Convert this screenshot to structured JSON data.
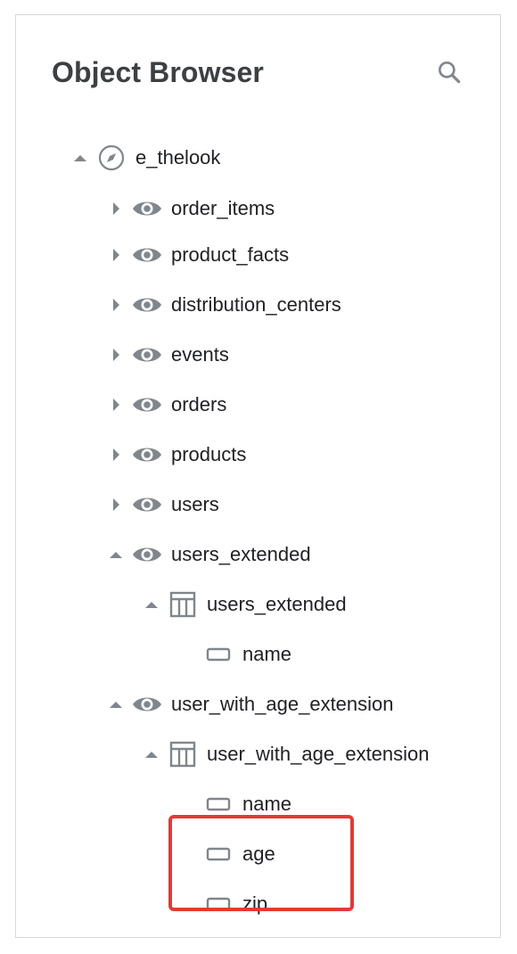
{
  "panel": {
    "title": "Object Browser",
    "search_icon": "search-icon"
  },
  "tree": {
    "root": {
      "label": "e_thelook",
      "icon": "compass-icon",
      "expanded": true
    },
    "views": [
      {
        "label": "order_items",
        "icon": "eye-icon",
        "expanded": false
      },
      {
        "label": "product_facts",
        "icon": "eye-icon",
        "expanded": false
      },
      {
        "label": "distribution_centers",
        "icon": "eye-icon",
        "expanded": false
      },
      {
        "label": "events",
        "icon": "eye-icon",
        "expanded": false
      },
      {
        "label": "orders",
        "icon": "eye-icon",
        "expanded": false
      },
      {
        "label": "products",
        "icon": "eye-icon",
        "expanded": false
      },
      {
        "label": "users",
        "icon": "eye-icon",
        "expanded": false
      },
      {
        "label": "users_extended",
        "icon": "eye-icon",
        "expanded": true,
        "explore": {
          "label": "users_extended",
          "icon": "table-icon",
          "expanded": true
        },
        "fields": [
          {
            "label": "name",
            "icon": "dimension-icon"
          }
        ]
      },
      {
        "label": "user_with_age_extension",
        "icon": "eye-icon",
        "expanded": true,
        "explore": {
          "label": "user_with_age_extension",
          "icon": "table-icon",
          "expanded": true
        },
        "fields": [
          {
            "label": "name",
            "icon": "dimension-icon"
          },
          {
            "label": "age",
            "icon": "dimension-icon"
          },
          {
            "label": "zip",
            "icon": "dimension-icon"
          }
        ]
      }
    ]
  },
  "colors": {
    "icon_gray": "#80868b",
    "highlight_red": "#e53935",
    "text": "#202124",
    "title": "#3c4043"
  }
}
